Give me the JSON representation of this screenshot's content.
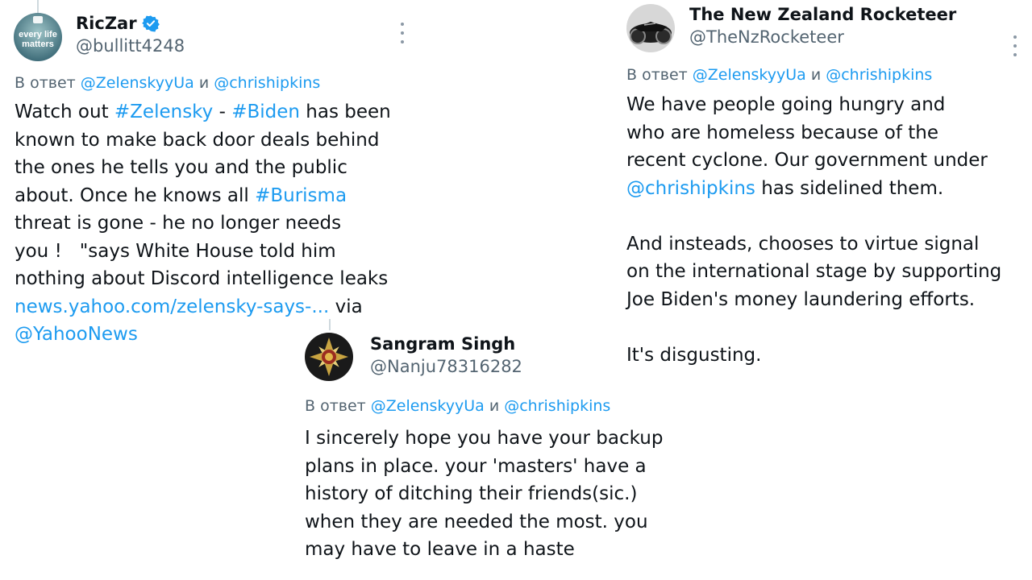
{
  "tweet1": {
    "name": "RicZar",
    "handle": "@bullitt4248",
    "avatar_text_1": "every life",
    "avatar_text_2": "matters",
    "reply_prefix": "В ответ",
    "reply_mention_1": "@ZelenskyyUa",
    "reply_conj": "и",
    "reply_mention_2": "@chrishipkins",
    "lines": [
      [
        "Watch out ",
        "#Zelensky",
        " - ",
        "#Biden",
        " has been"
      ],
      [
        "known to make back door deals behind"
      ],
      [
        "the ones he tells you and the public"
      ],
      [
        "about. Once he knows all ",
        "#Burisma"
      ],
      [
        "threat is gone - he no longer needs"
      ],
      [
        "you !   \"says White House told him"
      ],
      [
        "nothing about Discord intelligence leaks"
      ],
      [
        "news.yahoo.com/zelensky-says-...",
        " via"
      ],
      [
        "@YahooNews"
      ]
    ]
  },
  "tweet2": {
    "name": "The New Zealand Rocketeer",
    "handle": "@TheNzRocketeer",
    "reply_prefix": "В ответ",
    "reply_mention_1": "@ZelenskyyUa",
    "reply_conj": "и",
    "reply_mention_2": "@chrishipkins",
    "lines": [
      "We have people going hungry and",
      "who are homeless because of the",
      "recent cyclone. Our government under",
      "@chrishipkins",
      " has sidelined them.",
      "And insteads, chooses to virtue signal",
      "on the international stage by supporting",
      "Joe Biden's money laundering efforts.",
      "It's disgusting."
    ]
  },
  "tweet3": {
    "name": "Sangram Singh",
    "handle": "@Nanju78316282",
    "reply_prefix": "В ответ",
    "reply_mention_1": "@ZelenskyyUa",
    "reply_conj": "и",
    "reply_mention_2": "@chrishipkins",
    "lines": [
      "I sincerely hope you have your backup",
      "plans in place. your 'masters' have a",
      "history of ditching their friends(sic.)",
      "when they are needed the most. you",
      "may have to leave in a haste"
    ]
  },
  "colors": {
    "link": "#1d9bf0",
    "text": "#0f1419",
    "muted": "#536471"
  }
}
